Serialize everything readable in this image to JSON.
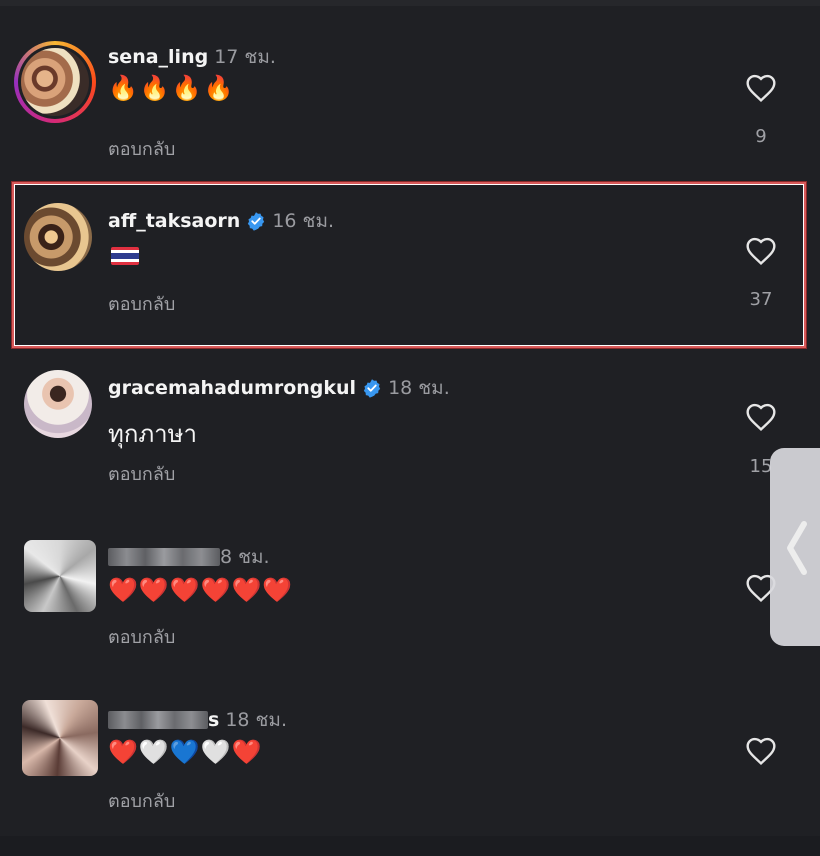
{
  "comments": [
    {
      "username": "sena_ling",
      "time": "17 ชม.",
      "text": "🔥🔥🔥🔥",
      "reply": "ตอบกลับ",
      "likes": "9",
      "verified": false
    },
    {
      "username": "aff_taksaorn",
      "time": "16 ชม.",
      "text": "🇹🇭",
      "reply": "ตอบกลับ",
      "likes": "37",
      "verified": true
    },
    {
      "username": "gracemahadumrongkul",
      "time": "18 ชม.",
      "text": "ทุกภาษา",
      "reply": "ตอบกลับ",
      "likes": "15",
      "verified": true
    },
    {
      "username": "",
      "time": "8 ชม.",
      "text": "❤️❤️❤️❤️❤️❤️",
      "reply": "ตอบกลับ",
      "likes": "",
      "verified": false
    },
    {
      "username": "s",
      "time": "18 ชม.",
      "text": "❤️🤍💙🤍❤️",
      "reply": "ตอบกลับ",
      "likes": "",
      "verified": false
    }
  ],
  "colors": {
    "background": "#1f2024",
    "highlight_border": "#d85a5a",
    "verified": "#3897f0",
    "muted_text": "#9a9ba0"
  },
  "icons": {
    "like": "heart-outline-icon",
    "verified": "verified-badge-icon",
    "side_tab": "chevron-left-icon"
  }
}
